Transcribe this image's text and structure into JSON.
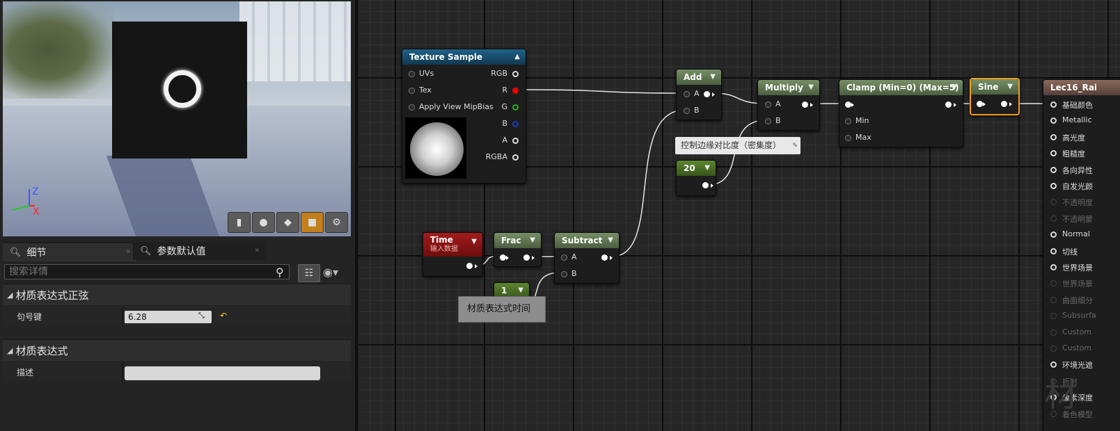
{
  "viewport": {
    "axis_z": "Z",
    "axis_x": "X",
    "buttons": [
      {
        "icon": "cylinder-icon",
        "glyph": "▮"
      },
      {
        "icon": "sphere-icon",
        "glyph": "●"
      },
      {
        "icon": "plane-icon",
        "glyph": "◆"
      },
      {
        "icon": "cube-icon",
        "glyph": "■"
      },
      {
        "icon": "teapot-icon",
        "glyph": "⚙"
      }
    ]
  },
  "details_panel": {
    "tabs": [
      {
        "label": "细节",
        "icon": "magnifier-icon"
      },
      {
        "label": "参数默认值",
        "icon": "magnifier-icon"
      }
    ],
    "search_placeholder": "搜索详情",
    "sections": [
      {
        "title": "材质表达式正弦",
        "property": {
          "label": "句号键",
          "value": "6.28"
        }
      },
      {
        "title": "材质表达式",
        "property": {
          "label": "描述",
          "value": ""
        }
      }
    ]
  },
  "graph": {
    "texture_sample": {
      "title": "Texture Sample",
      "inputs": [
        "UVs",
        "Tex",
        "Apply View MipBias"
      ],
      "outputs": [
        "RGB",
        "R",
        "G",
        "B",
        "A",
        "RGBA"
      ]
    },
    "add": {
      "title": "Add",
      "inputs": [
        "A",
        "B"
      ]
    },
    "multiply": {
      "title": "Multiply",
      "inputs": [
        "A",
        "B"
      ]
    },
    "clamp": {
      "title": "Clamp (Min=0) (Max=5)",
      "inputs": [
        "Min",
        "Max"
      ]
    },
    "sine": {
      "title": "Sine"
    },
    "result": {
      "title": "Lec16_Rai",
      "inputs": [
        "基础颜色",
        "Metallic",
        "高光度",
        "粗糙度",
        "各向异性",
        "自发光颜",
        "不透明度",
        "不透明蒙",
        "Normal",
        "切线",
        "世界场景",
        "世界场景",
        "曲面细分",
        "Subsurfa",
        "Custom",
        "Custom",
        "环境光遮",
        "折射",
        "像素深度",
        "着色模型"
      ],
      "enabled": [
        true,
        true,
        true,
        true,
        true,
        true,
        false,
        false,
        true,
        true,
        true,
        false,
        false,
        false,
        false,
        false,
        true,
        false,
        true,
        false
      ]
    },
    "const_20": {
      "value": "20"
    },
    "const_1": {
      "value": "1"
    },
    "time": {
      "title": "Time",
      "subtitle": "输入数据"
    },
    "frac": {
      "title": "Frac"
    },
    "subtract": {
      "title": "Subtract",
      "inputs": [
        "A",
        "B"
      ]
    },
    "comment": "控制边缘对比度（密集度）",
    "tooltip": "材质表达式时间",
    "watermark": "材"
  },
  "colors": {
    "accent_selected": "#f39b1b",
    "r_pin": "#e00000",
    "g_pin": "#1db31d",
    "b_pin": "#1a3abf"
  }
}
